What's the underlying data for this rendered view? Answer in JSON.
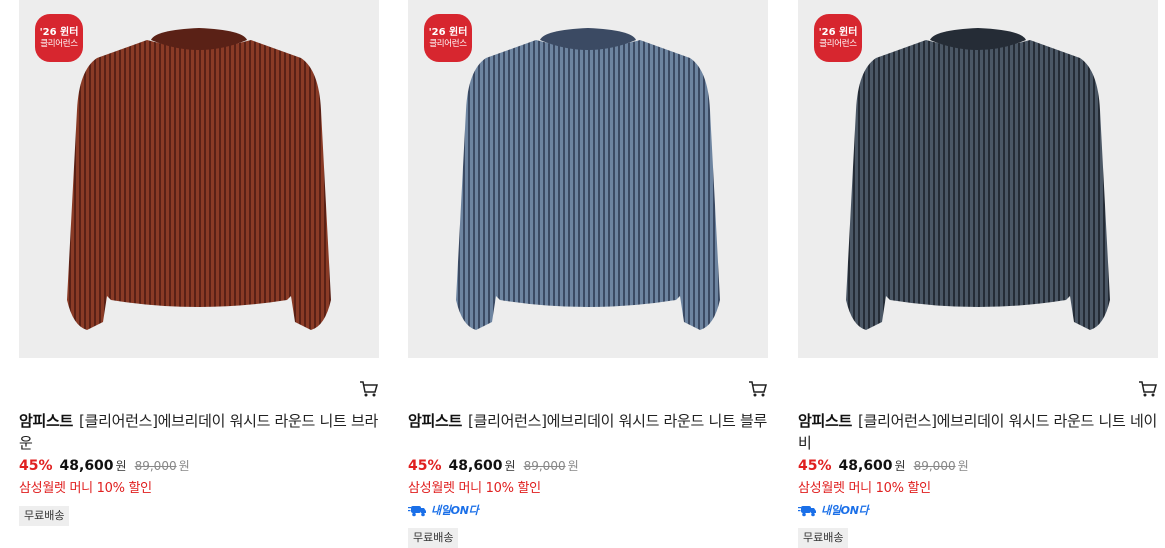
{
  "colors": {
    "accent_red": "#e02020",
    "badge_red": "#d7262f",
    "tomorrow_blue": "#1a6fe8"
  },
  "products": [
    {
      "badge_line1": "'26 윈터",
      "badge_line2": "클리어런스",
      "brand": "암피스트",
      "name": "[클리어런스]에브리데이 워시드 라운드 니트 브라운",
      "discount": "45%",
      "price": "48,600",
      "currency": "원",
      "original_price": "89,000",
      "original_currency": "원",
      "promo": "삼성월렛 머니 10% 할인",
      "delivery_badge": "",
      "shipping": "무료배송",
      "sweater_color": "#8a3b26",
      "stripe_color": "#5a2116"
    },
    {
      "badge_line1": "'26 윈터",
      "badge_line2": "클리어런스",
      "brand": "암피스트",
      "name": "[클리어런스]에브리데이 워시드 라운드 니트 블루",
      "discount": "45%",
      "price": "48,600",
      "currency": "원",
      "original_price": "89,000",
      "original_currency": "원",
      "promo": "삼성월렛 머니 10% 할인",
      "delivery_badge": "내일ON다",
      "shipping": "무료배송",
      "sweater_color": "#6d84a0",
      "stripe_color": "#3b4a63"
    },
    {
      "badge_line1": "'26 윈터",
      "badge_line2": "클리어런스",
      "brand": "암피스트",
      "name": "[클리어런스]에브리데이 워시드 라운드 니트 네이비",
      "discount": "45%",
      "price": "48,600",
      "currency": "원",
      "original_price": "89,000",
      "original_currency": "원",
      "promo": "삼성월렛 머니 10% 할인",
      "delivery_badge": "내일ON다",
      "shipping": "무료배송",
      "sweater_color": "#4b5765",
      "stripe_color": "#252c36"
    }
  ]
}
